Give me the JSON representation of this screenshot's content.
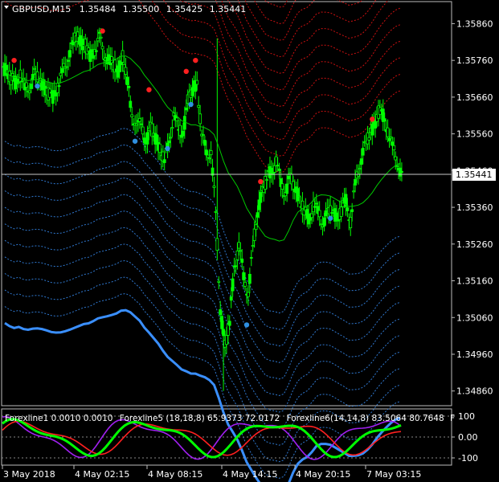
{
  "header": {
    "symbol": "GBPUSD,M15",
    "open": "1.35484",
    "high": "1.35500",
    "low": "1.35425",
    "close": "1.35441"
  },
  "price_axis": {
    "ticks": [
      "1.35860",
      "1.35760",
      "1.35660",
      "1.35560",
      "1.35460",
      "1.35360",
      "1.35260",
      "1.35160",
      "1.35060",
      "1.34960",
      "1.34860"
    ],
    "current_price_label": "1.35441"
  },
  "time_axis": {
    "ticks": [
      "3 May 2018",
      "4 May 02:15",
      "4 May 08:15",
      "4 May 14:15",
      "4 May 20:15",
      "7 May 03:15"
    ]
  },
  "indicator_header": {
    "forexline1": "Forexline1 0.0010 0.0010",
    "forexline5": "Forexline5 (18,18,8) 65.9373 72.0172",
    "forexline6": "Forexline6(14,14,8) 83.5064 80.7648",
    "truncated": "F"
  },
  "indicator_axis": {
    "ticks": [
      "100",
      "0.00",
      "-100"
    ]
  },
  "colors": {
    "background": "#000000",
    "candle": "#00ff00",
    "axis_text": "#ffffff",
    "ma_line": "#00c800",
    "upper_band": "#ff2020",
    "upper_band_dotted": "#cc1010",
    "lower_band": "#3a8fff",
    "lower_band_dotted": "#2f78d0",
    "signal_red": "#ff2020",
    "signal_blue": "#2f8fe0",
    "osc_green": "#00ff00",
    "osc_red": "#ff2020",
    "osc_purple": "#a020f0"
  },
  "chart_data": {
    "type": "candlestick",
    "ylim": [
      1.3482,
      1.3592
    ],
    "close_series": [
      1.3573,
      1.3571,
      1.357,
      1.3572,
      1.3568,
      1.3569,
      1.3572,
      1.3571,
      1.3569,
      1.3567,
      1.3566,
      1.3569,
      1.3572,
      1.3576,
      1.3579,
      1.3583,
      1.3581,
      1.358,
      1.3577,
      1.3579,
      1.3582,
      1.3578,
      1.3576,
      1.3575,
      1.3573,
      1.3577,
      1.357,
      1.3562,
      1.3557,
      1.356,
      1.3553,
      1.3558,
      1.3555,
      1.3552,
      1.3548,
      1.3555,
      1.356,
      1.3558,
      1.3556,
      1.3565,
      1.3568,
      1.357,
      1.3555,
      1.3552,
      1.355,
      1.3535,
      1.3508,
      1.3498,
      1.3505,
      1.352,
      1.3525,
      1.3518,
      1.3512,
      1.3525,
      1.3535,
      1.354,
      1.3544,
      1.3546,
      1.3548,
      1.3543,
      1.354,
      1.3544,
      1.3542,
      1.3538,
      1.3535,
      1.3533,
      1.3536,
      1.3535,
      1.3532,
      1.3534,
      1.3536,
      1.3533,
      1.3535,
      1.3538,
      1.3532,
      1.3542,
      1.3548,
      1.3552,
      1.3556,
      1.3558,
      1.3562,
      1.3561,
      1.3557,
      1.3552,
      1.3549,
      1.3544
    ],
    "series": [
      {
        "values": [
          0.001,
          0.001
        ]
      },
      {
        "values": [
          65.9373,
          72.0172
        ]
      },
      {
        "values": [
          83.5064,
          80.7648
        ]
      }
    ]
  }
}
